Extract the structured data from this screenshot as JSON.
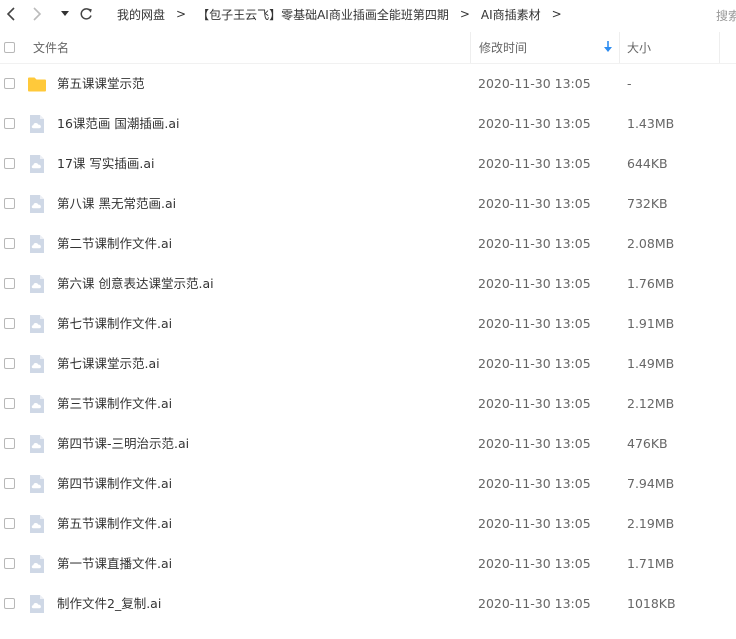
{
  "nav": {
    "breadcrumb": [
      "我的网盘",
      "【包子王云飞】零基础AI商业插画全能班第四期",
      "AI商插素材"
    ],
    "separator": ">",
    "search_label": "搜索"
  },
  "header": {
    "name_label": "文件名",
    "time_label": "修改时间",
    "size_label": "大小"
  },
  "colors": {
    "folder": "#FFC93A",
    "file_icon": "#CFD8E6",
    "sort_arrow": "#2D8CF0"
  },
  "files": [
    {
      "name": "第五课课堂示范",
      "time": "2020-11-30 13:05",
      "size": "-",
      "type": "folder"
    },
    {
      "name": "16课范画 国潮插画.ai",
      "time": "2020-11-30 13:05",
      "size": "1.43MB",
      "type": "file"
    },
    {
      "name": "17课 写实插画.ai",
      "time": "2020-11-30 13:05",
      "size": "644KB",
      "type": "file"
    },
    {
      "name": "第八课 黑无常范画.ai",
      "time": "2020-11-30 13:05",
      "size": "732KB",
      "type": "file"
    },
    {
      "name": "第二节课制作文件.ai",
      "time": "2020-11-30 13:05",
      "size": "2.08MB",
      "type": "file"
    },
    {
      "name": "第六课 创意表达课堂示范.ai",
      "time": "2020-11-30 13:05",
      "size": "1.76MB",
      "type": "file"
    },
    {
      "name": "第七节课制作文件.ai",
      "time": "2020-11-30 13:05",
      "size": "1.91MB",
      "type": "file"
    },
    {
      "name": "第七课课堂示范.ai",
      "time": "2020-11-30 13:05",
      "size": "1.49MB",
      "type": "file"
    },
    {
      "name": "第三节课制作文件.ai",
      "time": "2020-11-30 13:05",
      "size": "2.12MB",
      "type": "file"
    },
    {
      "name": "第四节课-三明治示范.ai",
      "time": "2020-11-30 13:05",
      "size": "476KB",
      "type": "file"
    },
    {
      "name": "第四节课制作文件.ai",
      "time": "2020-11-30 13:05",
      "size": "7.94MB",
      "type": "file"
    },
    {
      "name": "第五节课制作文件.ai",
      "time": "2020-11-30 13:05",
      "size": "2.19MB",
      "type": "file"
    },
    {
      "name": "第一节课直播文件.ai",
      "time": "2020-11-30 13:05",
      "size": "1.71MB",
      "type": "file"
    },
    {
      "name": "制作文件2_复制.ai",
      "time": "2020-11-30 13:05",
      "size": "1018KB",
      "type": "file"
    }
  ]
}
